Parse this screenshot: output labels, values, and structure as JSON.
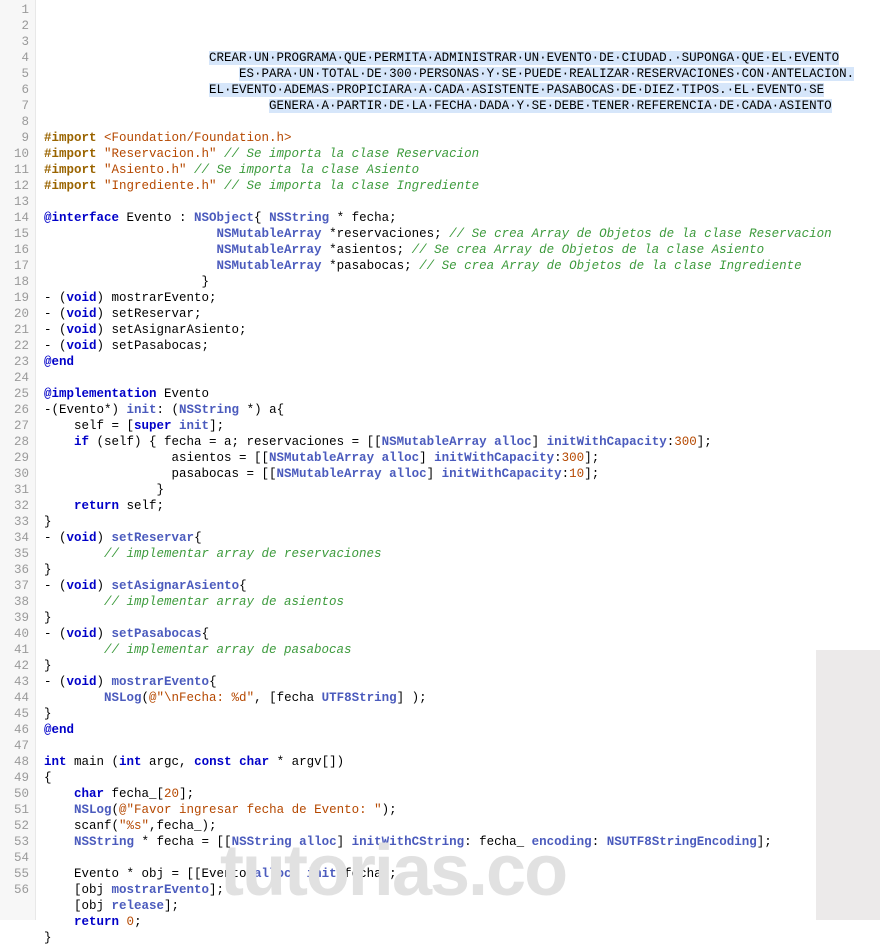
{
  "watermark": "tutorias.co",
  "lines": [
    {
      "n": 1,
      "type": "banner",
      "text": "CREAR UN PROGRAMA QUE PERMITA ADMINISTRAR UN EVENTO DE CIUDAD. SUPONGA QUE EL EVENTO"
    },
    {
      "n": 2,
      "type": "banner",
      "text": "ES PARA UN TOTAL DE 300 PERSONAS Y SE PUEDE REALIZAR RESERVACIONES CON ANTELACION."
    },
    {
      "n": 3,
      "type": "banner",
      "text": "EL EVENTO ADEMAS PROPICIARA A CADA ASISTENTE PASABOCAS DE DIEZ TIPOS. EL EVENTO SE"
    },
    {
      "n": 4,
      "type": "banner",
      "text": "GENERA A PARTIR DE LA FECHA DADA Y SE DEBE TENER REFERENCIA DE CADA ASIENTO"
    },
    {
      "n": 5,
      "type": "blank"
    },
    {
      "n": 6,
      "type": "code",
      "tokens": [
        [
          "pp",
          "#import "
        ],
        [
          "str",
          "<Foundation/Foundation.h>"
        ]
      ]
    },
    {
      "n": 7,
      "type": "code",
      "tokens": [
        [
          "pp",
          "#import "
        ],
        [
          "str",
          "\"Reservacion.h\" "
        ],
        [
          "cm",
          "// Se importa la clase Reservacion"
        ]
      ]
    },
    {
      "n": 8,
      "type": "code",
      "tokens": [
        [
          "pp",
          "#import "
        ],
        [
          "str",
          "\"Asiento.h\" "
        ],
        [
          "cm",
          "// Se importa la clase Asiento"
        ]
      ]
    },
    {
      "n": 9,
      "type": "code",
      "tokens": [
        [
          "pp",
          "#import "
        ],
        [
          "str",
          "\"Ingrediente.h\" "
        ],
        [
          "cm",
          "// Se importa la clase Ingrediente"
        ]
      ]
    },
    {
      "n": 10,
      "type": "blank"
    },
    {
      "n": 11,
      "type": "code",
      "tokens": [
        [
          "kw",
          "@interface"
        ],
        [
          "id",
          " Evento : "
        ],
        [
          "cls",
          "NSObject"
        ],
        [
          "id",
          "{ "
        ],
        [
          "cls",
          "NSString"
        ],
        [
          "id",
          " * fecha;"
        ]
      ]
    },
    {
      "n": 12,
      "type": "code",
      "tokens": [
        [
          "id",
          "                       "
        ],
        [
          "cls",
          "NSMutableArray"
        ],
        [
          "id",
          " *reservaciones; "
        ],
        [
          "cm",
          "// Se crea Array de Objetos de la clase Reservacion"
        ]
      ]
    },
    {
      "n": 13,
      "type": "code",
      "tokens": [
        [
          "id",
          "                       "
        ],
        [
          "cls",
          "NSMutableArray"
        ],
        [
          "id",
          " *asientos; "
        ],
        [
          "cm",
          "// Se crea Array de Objetos de la clase Asiento"
        ]
      ]
    },
    {
      "n": 14,
      "type": "code",
      "tokens": [
        [
          "id",
          "                       "
        ],
        [
          "cls",
          "NSMutableArray"
        ],
        [
          "id",
          " *pasabocas; "
        ],
        [
          "cm",
          "// Se crea Array de Objetos de la clase Ingrediente"
        ]
      ]
    },
    {
      "n": 15,
      "type": "code",
      "tokens": [
        [
          "id",
          "                     }"
        ]
      ]
    },
    {
      "n": 16,
      "type": "code",
      "tokens": [
        [
          "id",
          "- ("
        ],
        [
          "kw",
          "void"
        ],
        [
          "id",
          ") mostrarEvento;"
        ]
      ]
    },
    {
      "n": 17,
      "type": "code",
      "tokens": [
        [
          "id",
          "- ("
        ],
        [
          "kw",
          "void"
        ],
        [
          "id",
          ") setReservar;"
        ]
      ]
    },
    {
      "n": 18,
      "type": "code",
      "tokens": [
        [
          "id",
          "- ("
        ],
        [
          "kw",
          "void"
        ],
        [
          "id",
          ") setAsignarAsiento;"
        ]
      ]
    },
    {
      "n": 19,
      "type": "code",
      "tokens": [
        [
          "id",
          "- ("
        ],
        [
          "kw",
          "void"
        ],
        [
          "id",
          ") setPasabocas;"
        ]
      ]
    },
    {
      "n": 20,
      "type": "code",
      "tokens": [
        [
          "kw",
          "@end"
        ]
      ]
    },
    {
      "n": 21,
      "type": "blank"
    },
    {
      "n": 22,
      "type": "code",
      "tokens": [
        [
          "kw",
          "@implementation"
        ],
        [
          "id",
          " Evento"
        ]
      ]
    },
    {
      "n": 23,
      "type": "code",
      "tokens": [
        [
          "id",
          "-(Evento*) "
        ],
        [
          "mth",
          "init"
        ],
        [
          "id",
          ": ("
        ],
        [
          "cls",
          "NSString"
        ],
        [
          "id",
          " *) "
        ],
        [
          "id",
          "a"
        ],
        [
          "id",
          "{"
        ]
      ]
    },
    {
      "n": 24,
      "type": "code",
      "tokens": [
        [
          "id",
          "    self = ["
        ],
        [
          "kw",
          "super"
        ],
        [
          "id",
          " "
        ],
        [
          "mth",
          "init"
        ],
        [
          "id",
          "];"
        ]
      ]
    },
    {
      "n": 25,
      "type": "code",
      "tokens": [
        [
          "id",
          "    "
        ],
        [
          "kw",
          "if"
        ],
        [
          "id",
          " (self) { fecha = a; reservaciones = [["
        ],
        [
          "cls",
          "NSMutableArray"
        ],
        [
          "id",
          " "
        ],
        [
          "mth",
          "alloc"
        ],
        [
          "id",
          "] "
        ],
        [
          "mth",
          "initWithCapacity"
        ],
        [
          "id",
          ":"
        ],
        [
          "num",
          "300"
        ],
        [
          "id",
          "];"
        ]
      ]
    },
    {
      "n": 26,
      "type": "code",
      "tokens": [
        [
          "id",
          "                 asientos = [["
        ],
        [
          "cls",
          "NSMutableArray"
        ],
        [
          "id",
          " "
        ],
        [
          "mth",
          "alloc"
        ],
        [
          "id",
          "] "
        ],
        [
          "mth",
          "initWithCapacity"
        ],
        [
          "id",
          ":"
        ],
        [
          "num",
          "300"
        ],
        [
          "id",
          "];"
        ]
      ]
    },
    {
      "n": 27,
      "type": "code",
      "tokens": [
        [
          "id",
          "                 pasabocas = [["
        ],
        [
          "cls",
          "NSMutableArray"
        ],
        [
          "id",
          " "
        ],
        [
          "mth",
          "alloc"
        ],
        [
          "id",
          "] "
        ],
        [
          "mth",
          "initWithCapacity"
        ],
        [
          "id",
          ":"
        ],
        [
          "num",
          "10"
        ],
        [
          "id",
          "];"
        ]
      ]
    },
    {
      "n": 28,
      "type": "code",
      "tokens": [
        [
          "id",
          "               }"
        ]
      ]
    },
    {
      "n": 29,
      "type": "code",
      "tokens": [
        [
          "id",
          "    "
        ],
        [
          "kw",
          "return"
        ],
        [
          "id",
          " self;"
        ]
      ]
    },
    {
      "n": 30,
      "type": "code",
      "tokens": [
        [
          "id",
          "}"
        ]
      ]
    },
    {
      "n": 31,
      "type": "code",
      "tokens": [
        [
          "id",
          "- ("
        ],
        [
          "kw",
          "void"
        ],
        [
          "id",
          ") "
        ],
        [
          "mth",
          "setReservar"
        ],
        [
          "id",
          "{"
        ]
      ]
    },
    {
      "n": 32,
      "type": "code",
      "tokens": [
        [
          "id",
          "        "
        ],
        [
          "cm",
          "// implementar array de reservaciones"
        ]
      ]
    },
    {
      "n": 33,
      "type": "code",
      "tokens": [
        [
          "id",
          "}"
        ]
      ]
    },
    {
      "n": 34,
      "type": "code",
      "tokens": [
        [
          "id",
          "- ("
        ],
        [
          "kw",
          "void"
        ],
        [
          "id",
          ") "
        ],
        [
          "mth",
          "setAsignarAsiento"
        ],
        [
          "id",
          "{"
        ]
      ]
    },
    {
      "n": 35,
      "type": "code",
      "tokens": [
        [
          "id",
          "        "
        ],
        [
          "cm",
          "// implementar array de asientos"
        ]
      ]
    },
    {
      "n": 36,
      "type": "code",
      "tokens": [
        [
          "id",
          "}"
        ]
      ]
    },
    {
      "n": 37,
      "type": "code",
      "tokens": [
        [
          "id",
          "- ("
        ],
        [
          "kw",
          "void"
        ],
        [
          "id",
          ") "
        ],
        [
          "mth",
          "setPasabocas"
        ],
        [
          "id",
          "{"
        ]
      ]
    },
    {
      "n": 38,
      "type": "code",
      "tokens": [
        [
          "id",
          "        "
        ],
        [
          "cm",
          "// implementar array de pasabocas"
        ]
      ]
    },
    {
      "n": 39,
      "type": "code",
      "tokens": [
        [
          "id",
          "}"
        ]
      ]
    },
    {
      "n": 40,
      "type": "code",
      "tokens": [
        [
          "id",
          "- ("
        ],
        [
          "kw",
          "void"
        ],
        [
          "id",
          ") "
        ],
        [
          "mth",
          "mostrarEvento"
        ],
        [
          "id",
          "{"
        ]
      ]
    },
    {
      "n": 41,
      "type": "code",
      "tokens": [
        [
          "id",
          "        "
        ],
        [
          "cls",
          "NSLog"
        ],
        [
          "id",
          "("
        ],
        [
          "str",
          "@\"\\nFecha: %d\""
        ],
        [
          "id",
          ", [fecha "
        ],
        [
          "mth",
          "UTF8String"
        ],
        [
          "id",
          "] );"
        ]
      ]
    },
    {
      "n": 42,
      "type": "code",
      "tokens": [
        [
          "id",
          "}"
        ]
      ]
    },
    {
      "n": 43,
      "type": "code",
      "tokens": [
        [
          "kw",
          "@end"
        ]
      ]
    },
    {
      "n": 44,
      "type": "blank"
    },
    {
      "n": 45,
      "type": "code",
      "tokens": [
        [
          "kw",
          "int"
        ],
        [
          "id",
          " main ("
        ],
        [
          "kw",
          "int"
        ],
        [
          "id",
          " argc, "
        ],
        [
          "kw",
          "const"
        ],
        [
          "id",
          " "
        ],
        [
          "kw",
          "char"
        ],
        [
          "id",
          " * argv[])"
        ]
      ]
    },
    {
      "n": 46,
      "type": "code",
      "tokens": [
        [
          "id",
          "{"
        ]
      ]
    },
    {
      "n": 47,
      "type": "code",
      "tokens": [
        [
          "id",
          "    "
        ],
        [
          "kw",
          "char"
        ],
        [
          "id",
          " fecha_["
        ],
        [
          "num",
          "20"
        ],
        [
          "id",
          "];"
        ]
      ]
    },
    {
      "n": 48,
      "type": "code",
      "tokens": [
        [
          "id",
          "    "
        ],
        [
          "cls",
          "NSLog"
        ],
        [
          "id",
          "("
        ],
        [
          "str",
          "@\"Favor ingresar fecha de Evento: \""
        ],
        [
          "id",
          ");"
        ]
      ]
    },
    {
      "n": 49,
      "type": "code",
      "tokens": [
        [
          "id",
          "    scanf("
        ],
        [
          "str",
          "\"%s\""
        ],
        [
          "id",
          ",fecha_);"
        ]
      ]
    },
    {
      "n": 50,
      "type": "code",
      "tokens": [
        [
          "id",
          "    "
        ],
        [
          "cls",
          "NSString"
        ],
        [
          "id",
          " * fecha = [["
        ],
        [
          "cls",
          "NSString"
        ],
        [
          "id",
          " "
        ],
        [
          "mth",
          "alloc"
        ],
        [
          "id",
          "] "
        ],
        [
          "mth",
          "initWithCString"
        ],
        [
          "id",
          ": fecha_ "
        ],
        [
          "mth",
          "encoding"
        ],
        [
          "id",
          ": "
        ],
        [
          "cls",
          "NSUTF8StringEncoding"
        ],
        [
          "id",
          "];"
        ]
      ]
    },
    {
      "n": 51,
      "type": "blank"
    },
    {
      "n": 52,
      "type": "code",
      "tokens": [
        [
          "id",
          "    Evento * obj = [[Evento "
        ],
        [
          "mth",
          "alloc"
        ],
        [
          "id",
          "] "
        ],
        [
          "mth",
          "init"
        ],
        [
          "id",
          ":fecha];"
        ]
      ]
    },
    {
      "n": 53,
      "type": "code",
      "tokens": [
        [
          "id",
          "    [obj "
        ],
        [
          "mth",
          "mostrarEvento"
        ],
        [
          "id",
          "];"
        ]
      ]
    },
    {
      "n": 54,
      "type": "code",
      "tokens": [
        [
          "id",
          "    [obj "
        ],
        [
          "mth",
          "release"
        ],
        [
          "id",
          "];"
        ]
      ]
    },
    {
      "n": 55,
      "type": "code",
      "tokens": [
        [
          "id",
          "    "
        ],
        [
          "kw",
          "return"
        ],
        [
          "id",
          " "
        ],
        [
          "num",
          "0"
        ],
        [
          "id",
          ";"
        ]
      ]
    },
    {
      "n": 56,
      "type": "code",
      "tokens": [
        [
          "id",
          "}"
        ]
      ]
    }
  ]
}
